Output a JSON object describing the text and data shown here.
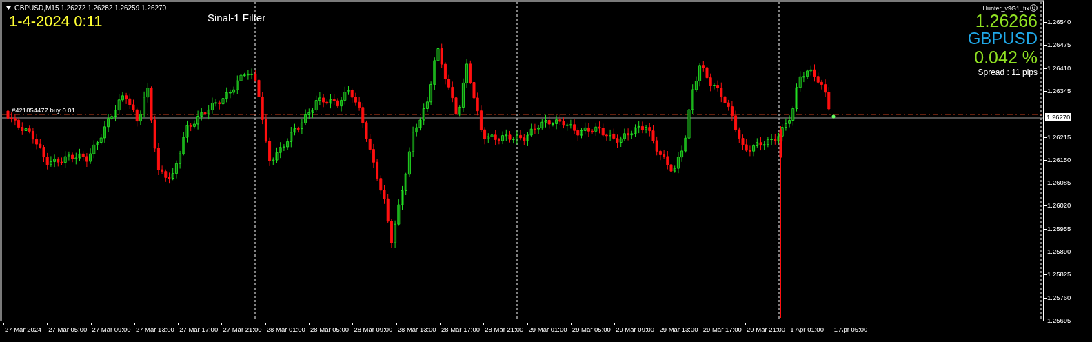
{
  "chart_header": {
    "symbol_info": "GBPUSD,M15 1.26272 1.26282 1.26259 1.26270"
  },
  "date_label": "1-4-2024 0:11",
  "indicator_label": "Sinal-1 Filter",
  "expert": {
    "name": "Hunter_v9G1_fix"
  },
  "info_panel": {
    "price": "1.26266",
    "symbol": "GBPUSD",
    "change": "0.042 %",
    "spread": "Spread : 11 pips"
  },
  "order_label": "#421854477 buy 0.01",
  "price_axis": {
    "ticks": [
      "1.26540",
      "1.26475",
      "1.26410",
      "1.26345",
      "1.26215",
      "1.26150",
      "1.26085",
      "1.26020",
      "1.25955",
      "1.25890",
      "1.25825",
      "1.25760",
      "1.25695"
    ],
    "current_price": "1.26270"
  },
  "time_axis": {
    "labels": [
      "27 Mar 2024",
      "27 Mar 05:00",
      "27 Mar 09:00",
      "27 Mar 13:00",
      "27 Mar 17:00",
      "27 Mar 21:00",
      "28 Mar 01:00",
      "28 Mar 05:00",
      "28 Mar 09:00",
      "28 Mar 13:00",
      "28 Mar 17:00",
      "28 Mar 21:00",
      "29 Mar 01:00",
      "29 Mar 05:00",
      "29 Mar 09:00",
      "29 Mar 13:00",
      "29 Mar 17:00",
      "29 Mar 21:00",
      "1 Apr 01:00",
      "1 Apr 05:00"
    ]
  }
}
